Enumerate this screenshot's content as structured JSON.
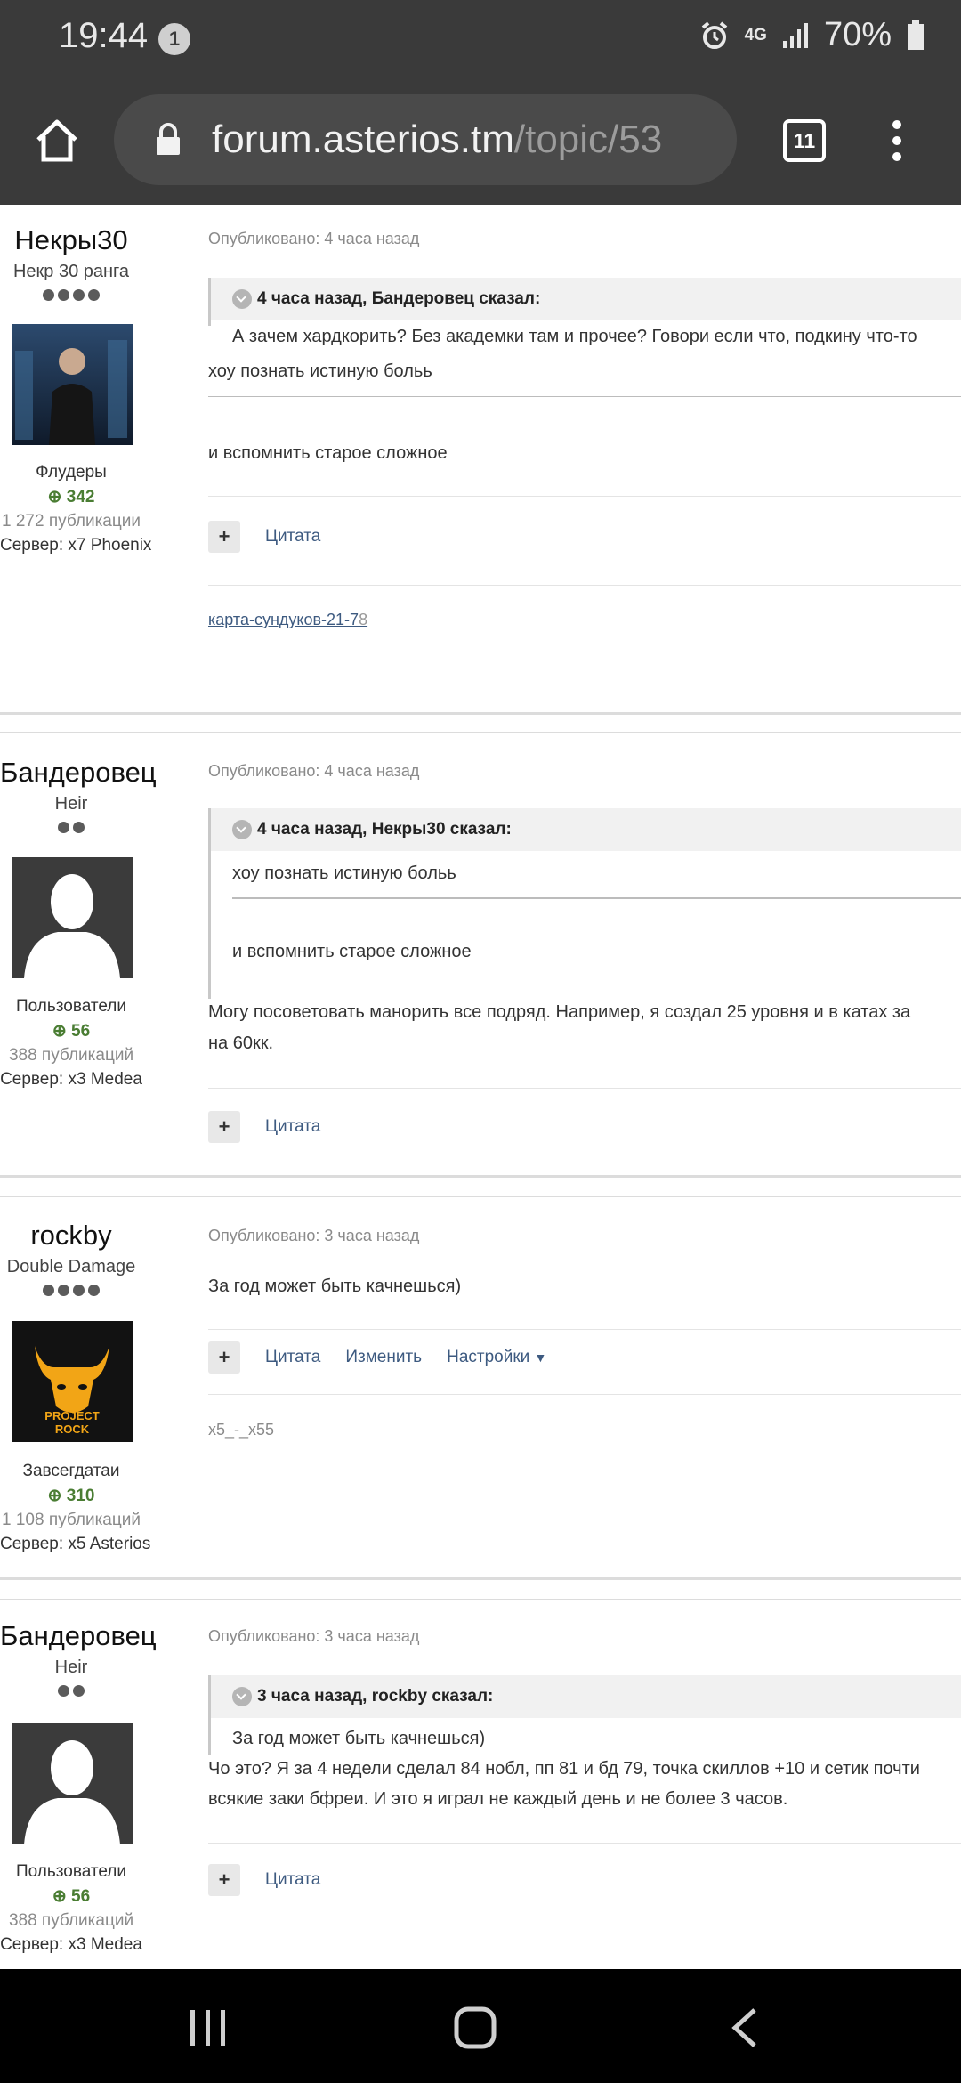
{
  "status_bar": {
    "time": "19:44",
    "notification_count": "1",
    "network": "4G",
    "battery": "70%"
  },
  "browser": {
    "url_host": "forum.asterios.tm",
    "url_path": "/topic/53",
    "tab_count": "11"
  },
  "posts": [
    {
      "author": {
        "name": "Некры30",
        "rank": "Некр 30 ранга",
        "group": "Флудеры",
        "reputation": "342",
        "posts_count": "1 272 публикации",
        "server": "Сервер: x7 Phoenix"
      },
      "published": "Опубликовано: 4 часа назад",
      "quote": {
        "header": "4 часа назад, Бандеровец сказал:",
        "text": "А зачем хардкорить? Без академки там и прочее? Говори если что, подкину что-то"
      },
      "body": [
        "хоу познать истиную больь",
        "и вспомнить старое сложное"
      ],
      "actions": [
        "Цитата"
      ],
      "signature": "карта-сундуков-21-7",
      "signature_extra": "8"
    },
    {
      "author": {
        "name": "Бандеровец",
        "rank": "Heir",
        "group": "Пользователи",
        "reputation": "56",
        "posts_count": "388 публикаций",
        "server": "Сервер: x3 Medea"
      },
      "published": "Опубликовано: 4 часа назад",
      "quote": {
        "header": "4 часа назад, Некры30 сказал:",
        "line1": "хоу познать истиную больь",
        "line2": "и вспомнить старое сложное"
      },
      "body": [
        "Могу посоветовать манорить все подряд. Например, я создал 25 уровня и в катах за",
        "на 60кк."
      ],
      "actions": [
        "Цитата"
      ]
    },
    {
      "author": {
        "name": "rockby",
        "rank": "Double Damage",
        "group": "Завсегдатаи",
        "reputation": "310",
        "posts_count": "1 108 публикаций",
        "server": "Сервер: x5 Asterios",
        "avatar_text_1": "PROJECT",
        "avatar_text_2": "ROCK"
      },
      "published": "Опубликовано: 3 часа назад",
      "body": [
        "За год может быть качнешься)"
      ],
      "actions": [
        "Цитата",
        "Изменить",
        "Настройки"
      ],
      "signature": "x5_-_x55"
    },
    {
      "author": {
        "name": "Бандеровец",
        "rank": "Heir",
        "group": "Пользователи",
        "reputation": "56",
        "posts_count": "388 публикаций",
        "server": "Сервер: x3 Medea"
      },
      "published": "Опубликовано: 3 часа назад",
      "quote": {
        "header": "3 часа назад, rockby сказал:",
        "text": "За год может быть качнешься)"
      },
      "body": [
        "Чо это? Я за 4 недели сделал 84 нобл, пп 81 и бд 79, точка скиллов +10 и сетик почти",
        "всякие заки бфреи. И это я играл не каждый день и не более 3 часов."
      ],
      "actions": [
        "Цитата"
      ]
    }
  ]
}
